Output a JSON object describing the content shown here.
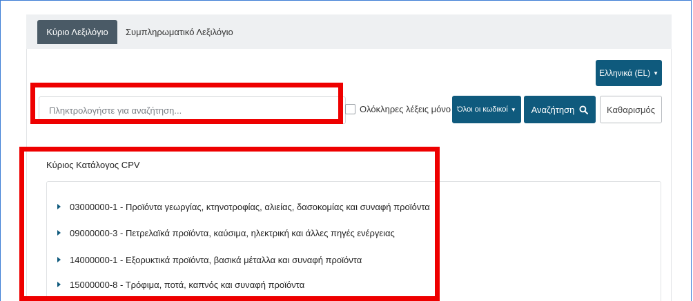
{
  "tabs": [
    {
      "label": "Κύριο Λεξιλόγιο",
      "active": true
    },
    {
      "label": "Συμπληρωματικό Λεξιλόγιο",
      "active": false
    }
  ],
  "language_button": {
    "label": "Ελληνικά (EL)"
  },
  "search": {
    "placeholder": "Πληκτρολογήστε για αναζήτηση...",
    "value": ""
  },
  "whole_words": {
    "label": "Ολόκληρες λέξεις μόνο",
    "checked": false
  },
  "codes_dropdown": {
    "label": "Όλοι οι κωδικοί"
  },
  "search_button": {
    "label": "Αναζήτηση"
  },
  "clear_button": {
    "label": "Καθαρισμός"
  },
  "catalog": {
    "title": "Κύριος Κατάλογος CPV",
    "items": [
      {
        "text": "03000000-1 - Προϊόντα γεωργίας, κτηνοτροφίας, αλιείας, δασοκομίας και συναφή προϊόντα"
      },
      {
        "text": "09000000-3 - Πετρελαϊκά προϊόντα, καύσιμα, ηλεκτρική και άλλες πηγές ενέργειας"
      },
      {
        "text": "14000000-1 - Εξορυκτικά προϊόντα, βασικά μέταλλα και συναφή προϊόντα"
      },
      {
        "text": "15000000-8 - Τρόφιμα, ποτά, καπνός και συναφή προϊόντα"
      }
    ]
  },
  "icons": {
    "search": "search-icon",
    "chevron": "chevron-right-icon",
    "caret": "caret-down-icon"
  },
  "colors": {
    "primary": "#0f5a7d",
    "tab_active": "#4a5a66",
    "highlight": "#ee0000"
  }
}
